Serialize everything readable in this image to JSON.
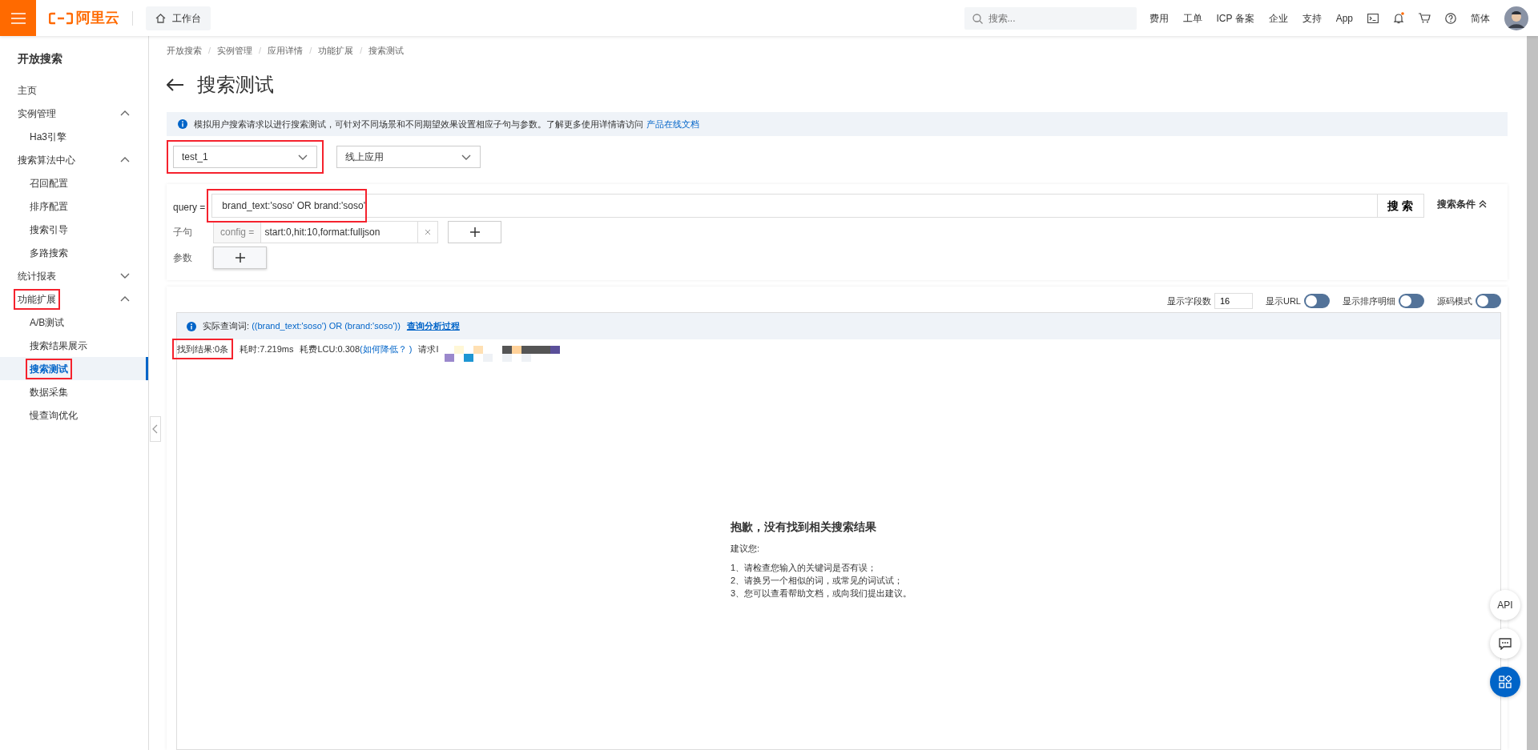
{
  "topbar": {
    "logo": "阿里云",
    "workbench": "工作台",
    "search": {
      "placeholder": "搜索..."
    },
    "links": [
      "费用",
      "工单",
      "ICP 备案",
      "企业",
      "支持",
      "App"
    ],
    "notifications": {
      "unread": true
    },
    "language": "简体"
  },
  "sidebar": {
    "title": "开放搜索",
    "items": [
      {
        "label": "主页",
        "selected": false,
        "highlighted": false
      },
      {
        "label": "实例管理",
        "selected": false,
        "highlighted": false,
        "expanded": true,
        "children": [
          {
            "label": "Ha3引擎",
            "selected": false,
            "highlighted": false
          }
        ]
      },
      {
        "label": "搜索算法中心",
        "selected": false,
        "highlighted": false,
        "expanded": true,
        "children": [
          {
            "label": "召回配置",
            "selected": false,
            "highlighted": false
          },
          {
            "label": "排序配置",
            "selected": false,
            "highlighted": false
          },
          {
            "label": "搜索引导",
            "selected": false,
            "highlighted": false
          },
          {
            "label": "多路搜索",
            "selected": false,
            "highlighted": false
          }
        ]
      },
      {
        "label": "统计报表",
        "selected": false,
        "highlighted": false,
        "expanded": false
      },
      {
        "label": "功能扩展",
        "selected": false,
        "highlighted": true,
        "expanded": true,
        "children": [
          {
            "label": "A/B测试",
            "selected": false,
            "highlighted": false
          },
          {
            "label": "搜索结果展示",
            "selected": false,
            "highlighted": false
          },
          {
            "label": "搜索测试",
            "selected": true,
            "highlighted": true
          },
          {
            "label": "数据采集",
            "selected": false,
            "highlighted": false
          },
          {
            "label": "慢查询优化",
            "selected": false,
            "highlighted": false
          }
        ]
      }
    ]
  },
  "breadcrumb": {
    "separator": "/",
    "items": [
      "开放搜索",
      "实例管理",
      "应用详情",
      "功能扩展",
      "搜索测试"
    ]
  },
  "page_title": "搜索测试",
  "info": {
    "text": "模拟用户搜索请求以进行搜索测试，可针对不同场景和不同期望效果设置相应子句与参数。了解更多使用详情请访问",
    "link": "产品在线文档"
  },
  "selects": [
    {
      "value": "test_1",
      "highlighted": true
    },
    {
      "value": "线上应用",
      "highlighted": false
    }
  ],
  "query": {
    "label": "query =",
    "value": "brand_text:'soso' OR brand:'soso'",
    "highlighted": true,
    "button": "搜 索",
    "conditions": {
      "label": "搜索条件",
      "expanded": true
    }
  },
  "clauses": {
    "label": "子句",
    "items": [
      {
        "key": "config =",
        "value": "start:0,hit:10,format:fulljson"
      }
    ]
  },
  "params": {
    "label": "参数"
  },
  "results": {
    "field_count": {
      "label": "显示字段数",
      "value": "16"
    },
    "toggles": [
      {
        "label": "显示URL",
        "on": false
      },
      {
        "label": "显示排序明细",
        "on": false
      },
      {
        "label": "源码模式",
        "on": false
      }
    ],
    "actual_query": {
      "label": "实际查询词:",
      "value": "((brand_text:'soso') OR (brand:'soso'))",
      "link": "查询分析过程"
    },
    "stats": {
      "count": "找到结果:0条",
      "count_highlighted": true,
      "time": "耗时:7.219ms",
      "cost": "耗费LCU:0.308",
      "cost_link": "(如何降低？ )",
      "request_id": "请求I"
    },
    "empty": {
      "title": "抱歉，没有找到相关搜索结果",
      "subtitle": "建议您:",
      "tips": [
        "1、请检查您输入的关键词是否有误；",
        "2、请换另一个相似的词，或常见的词试试；",
        "3、您可以查看帮助文档，或向我们提出建议。"
      ]
    }
  },
  "float_buttons": [
    {
      "kind": "text",
      "label": "API",
      "primary": false
    },
    {
      "kind": "chat",
      "primary": false
    },
    {
      "kind": "apps",
      "primary": true
    }
  ]
}
